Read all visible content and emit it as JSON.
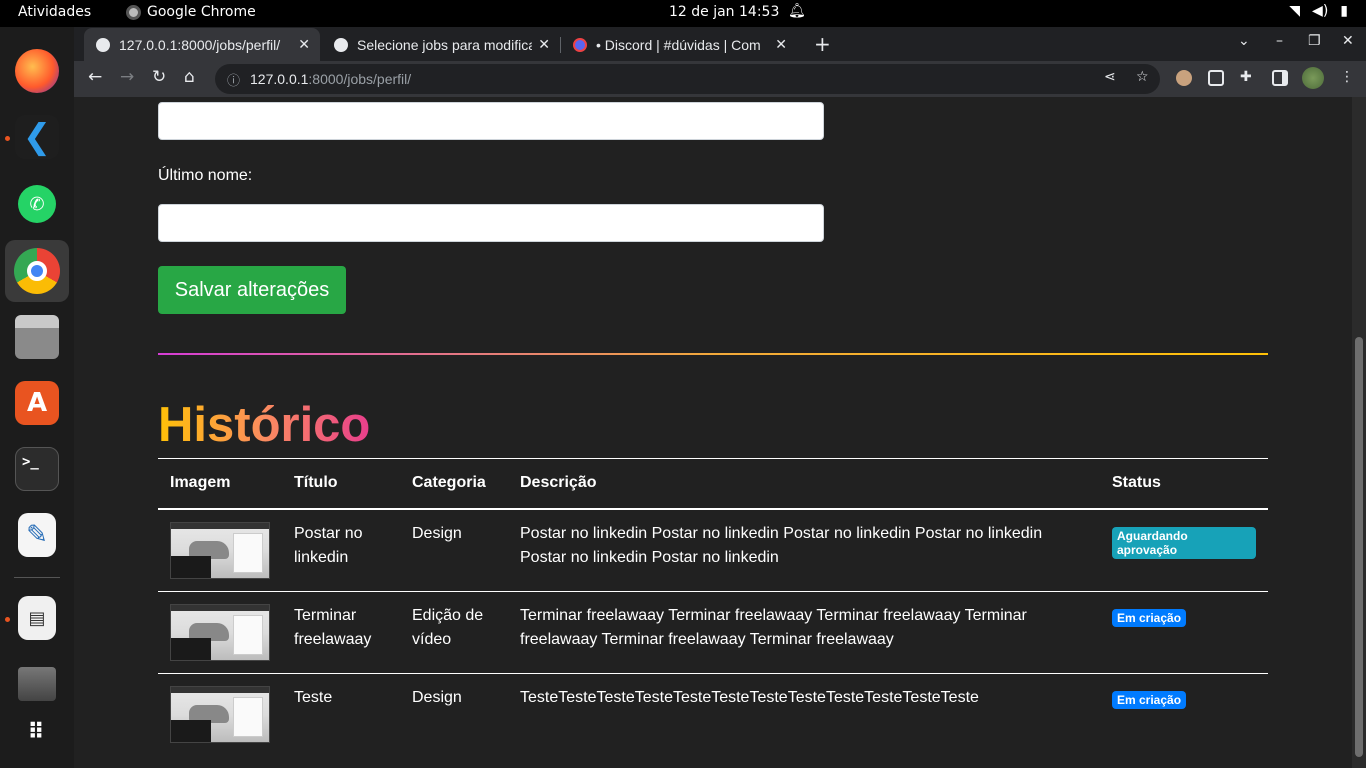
{
  "system": {
    "activities": "Atividades",
    "app_name": "Google Chrome",
    "clock": "12 de jan  14:53"
  },
  "browser": {
    "tabs": [
      {
        "title": "127.0.0.1:8000/jobs/perfil/",
        "active": true
      },
      {
        "title": "Selecione jobs para modificar",
        "active": false
      },
      {
        "title": "• Discord | #dúvidas | Com",
        "active": false
      }
    ],
    "url_host": "127.0.0.1",
    "url_path": ":8000/jobs/perfil/"
  },
  "form": {
    "last_name_label": "Último nome:",
    "first_name_value": "",
    "last_name_value": "",
    "save_label": "Salvar alterações"
  },
  "history": {
    "heading": "Histórico",
    "columns": [
      "Imagem",
      "Título",
      "Categoria",
      "Descrição",
      "Status"
    ],
    "rows": [
      {
        "title": "Postar no linkedin",
        "category": "Design",
        "description": "Postar no linkedin Postar no linkedin Postar no linkedin Postar no linkedin Postar no linkedin Postar no linkedin",
        "status": "Aguardando aprovação"
      },
      {
        "title": "Terminar freelawaay",
        "category": "Edição de vídeo",
        "description": "Terminar freelawaay Terminar freelawaay Terminar freelawaay Terminar freelawaay Terminar freelawaay Terminar freelawaay",
        "status": "Em criação"
      },
      {
        "title": "Teste",
        "category": "Design",
        "description": "TesteTesteTesteTesteTesteTesteTesteTesteTesteTesteTesteTeste",
        "status": "Em criação"
      }
    ]
  },
  "colors": {
    "save_button": "#28a745",
    "badge_info": "#17a2b8",
    "badge_primary": "#007bff",
    "page_bg": "#212121"
  }
}
